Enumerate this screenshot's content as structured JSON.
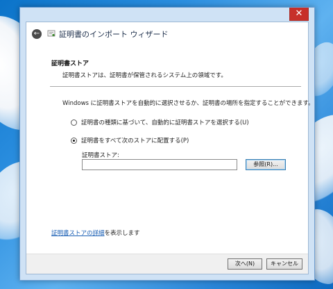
{
  "wizard": {
    "title": "証明書のインポート ウィザード"
  },
  "close_glyph": "✕",
  "back_glyph": "←",
  "section": {
    "title": "証明書ストア",
    "description": "証明書ストアは、証明書が保管されるシステム上の領域です。"
  },
  "intro": "Windows に証明書ストアを自動的に選択させるか、証明書の場所を指定することができます。",
  "options": [
    {
      "label": "証明書の種類に基づいて、自動的に証明書ストアを選択する(U)",
      "checked": false
    },
    {
      "label": "証明書をすべて次のストアに配置する(P)",
      "checked": true
    }
  ],
  "store": {
    "label": "証明書ストア:",
    "value": "",
    "browse_label": "参照(R)..."
  },
  "details": {
    "link_text": "証明書ストアの詳細",
    "suffix": "を表示します"
  },
  "footer": {
    "next_label": "次へ(N)",
    "cancel_label": "キャンセル"
  },
  "colors": {
    "close_button": "#c7302a",
    "link": "#1a5fb4",
    "window_frame": "#cfe2f5"
  }
}
